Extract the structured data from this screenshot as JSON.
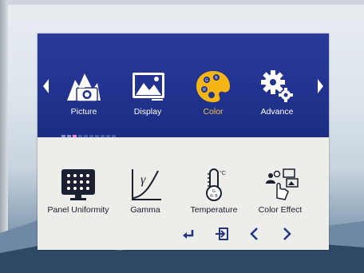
{
  "tabs": [
    {
      "label": "Picture",
      "icon": "picture-camera-icon"
    },
    {
      "label": "Display",
      "icon": "display-image-icon"
    },
    {
      "label": "Color",
      "icon": "color-palette-icon",
      "active": true
    },
    {
      "label": "Advance",
      "icon": "advance-gears-icon"
    }
  ],
  "page_indicator": {
    "count": 10,
    "current": 3
  },
  "items": [
    {
      "label": "Panel Uniformity",
      "icon": "panel-uniformity-icon"
    },
    {
      "label": "Gamma",
      "icon": "gamma-curve-icon"
    },
    {
      "label": "Temperature",
      "icon": "thermometer-icon"
    },
    {
      "label": "Color Effect",
      "icon": "color-effect-icon"
    }
  ],
  "temperature_unit": "°C",
  "colors": {
    "band": "#22338f",
    "active_label": "#f2c44a",
    "palette": "#f4b515",
    "panel": "#ededea"
  },
  "nav": [
    "enter-icon",
    "exit-icon",
    "left-icon",
    "right-icon"
  ]
}
